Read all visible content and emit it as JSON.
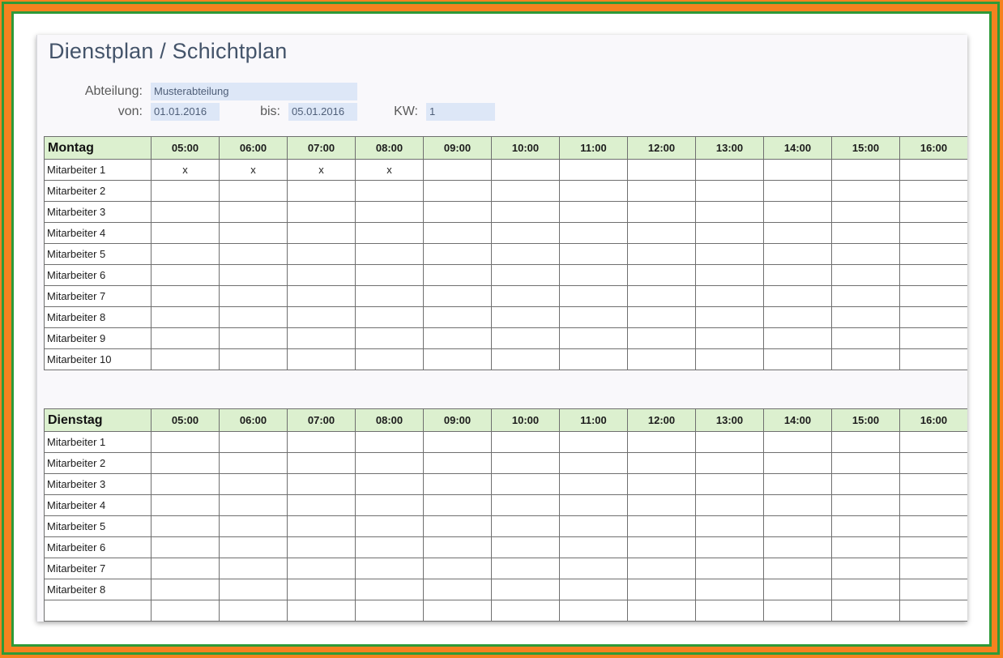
{
  "title": "Dienstplan / Schichtplan",
  "header": {
    "abteilung_label": "Abteilung:",
    "abteilung_value": "Musterabteilung",
    "von_label": "von:",
    "von_value": "01.01.2016",
    "bis_label": "bis:",
    "bis_value": "05.01.2016",
    "kw_label": "KW:",
    "kw_value": "1"
  },
  "times": [
    "05:00",
    "06:00",
    "07:00",
    "08:00",
    "09:00",
    "10:00",
    "11:00",
    "12:00",
    "13:00",
    "14:00",
    "15:00",
    "16:00"
  ],
  "days": [
    {
      "name": "Montag",
      "rows": [
        {
          "name": "Mitarbeiter 1",
          "cells": [
            "x",
            "x",
            "x",
            "x",
            "",
            "",
            "",
            "",
            "",
            "",
            "",
            ""
          ]
        },
        {
          "name": "Mitarbeiter 2",
          "cells": [
            "",
            "",
            "",
            "",
            "",
            "",
            "",
            "",
            "",
            "",
            "",
            ""
          ]
        },
        {
          "name": "Mitarbeiter 3",
          "cells": [
            "",
            "",
            "",
            "",
            "",
            "",
            "",
            "",
            "",
            "",
            "",
            ""
          ]
        },
        {
          "name": "Mitarbeiter 4",
          "cells": [
            "",
            "",
            "",
            "",
            "",
            "",
            "",
            "",
            "",
            "",
            "",
            ""
          ]
        },
        {
          "name": "Mitarbeiter 5",
          "cells": [
            "",
            "",
            "",
            "",
            "",
            "",
            "",
            "",
            "",
            "",
            "",
            ""
          ]
        },
        {
          "name": "Mitarbeiter 6",
          "cells": [
            "",
            "",
            "",
            "",
            "",
            "",
            "",
            "",
            "",
            "",
            "",
            ""
          ]
        },
        {
          "name": "Mitarbeiter 7",
          "cells": [
            "",
            "",
            "",
            "",
            "",
            "",
            "",
            "",
            "",
            "",
            "",
            ""
          ]
        },
        {
          "name": "Mitarbeiter 8",
          "cells": [
            "",
            "",
            "",
            "",
            "",
            "",
            "",
            "",
            "",
            "",
            "",
            ""
          ]
        },
        {
          "name": "Mitarbeiter 9",
          "cells": [
            "",
            "",
            "",
            "",
            "",
            "",
            "",
            "",
            "",
            "",
            "",
            ""
          ]
        },
        {
          "name": "Mitarbeiter 10",
          "cells": [
            "",
            "",
            "",
            "",
            "",
            "",
            "",
            "",
            "",
            "",
            "",
            ""
          ]
        }
      ]
    },
    {
      "name": "Dienstag",
      "rows": [
        {
          "name": "Mitarbeiter 1",
          "cells": [
            "",
            "",
            "",
            "",
            "",
            "",
            "",
            "",
            "",
            "",
            "",
            ""
          ]
        },
        {
          "name": "Mitarbeiter 2",
          "cells": [
            "",
            "",
            "",
            "",
            "",
            "",
            "",
            "",
            "",
            "",
            "",
            ""
          ]
        },
        {
          "name": "Mitarbeiter 3",
          "cells": [
            "",
            "",
            "",
            "",
            "",
            "",
            "",
            "",
            "",
            "",
            "",
            ""
          ]
        },
        {
          "name": "Mitarbeiter 4",
          "cells": [
            "",
            "",
            "",
            "",
            "",
            "",
            "",
            "",
            "",
            "",
            "",
            ""
          ]
        },
        {
          "name": "Mitarbeiter 5",
          "cells": [
            "",
            "",
            "",
            "",
            "",
            "",
            "",
            "",
            "",
            "",
            "",
            ""
          ]
        },
        {
          "name": "Mitarbeiter 6",
          "cells": [
            "",
            "",
            "",
            "",
            "",
            "",
            "",
            "",
            "",
            "",
            "",
            ""
          ]
        },
        {
          "name": "Mitarbeiter 7",
          "cells": [
            "",
            "",
            "",
            "",
            "",
            "",
            "",
            "",
            "",
            "",
            "",
            ""
          ]
        },
        {
          "name": "Mitarbeiter 8",
          "cells": [
            "",
            "",
            "",
            "",
            "",
            "",
            "",
            "",
            "",
            "",
            "",
            ""
          ]
        },
        {
          "name": "",
          "cells": [
            "",
            "",
            "",
            "",
            "",
            "",
            "",
            "",
            "",
            "",
            "",
            ""
          ]
        }
      ]
    }
  ],
  "colors": {
    "outer_orange": "#f5821f",
    "frame_green": "#2e9a38",
    "header_green": "#dcf0cf",
    "input_blue": "#dde7f7",
    "title_color": "#44546a"
  }
}
